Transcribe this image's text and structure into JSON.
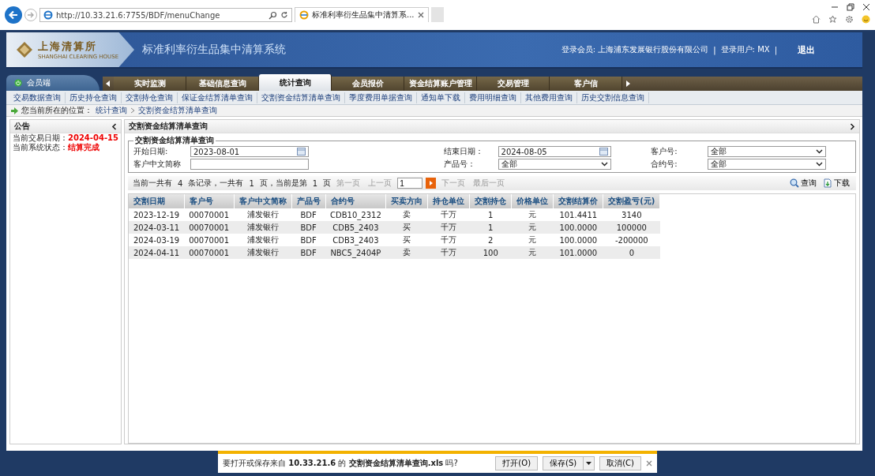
{
  "browser": {
    "address": "http://10.33.21.6:7755/BDF/menuChange",
    "tab_title": "标准利率衍生品集中清算系..."
  },
  "header": {
    "logo_text": "上海清算所",
    "logo_subtext": "SHANGHAI CLEARING HOUSE",
    "title": "标准利率衍生品集中清算系统",
    "login_member": "登录会员: 上海浦东发展银行股份有限公司",
    "login_user": "登录用户: MX",
    "separator": "|",
    "logout": "退出"
  },
  "member_tab": "会员端",
  "tabs": [
    {
      "label": "实时监测",
      "selected": false
    },
    {
      "label": "基础信息查询",
      "selected": false
    },
    {
      "label": "统计查询",
      "selected": true
    },
    {
      "label": "会员报价",
      "selected": false
    },
    {
      "label": "资金结算账户管理",
      "selected": false
    },
    {
      "label": "交易管理",
      "selected": false
    },
    {
      "label": "客户信",
      "selected": false
    }
  ],
  "submenu": [
    "交易数据查询",
    "历史持仓查询",
    "交割持仓查询",
    "保证金结算清单查询",
    "交割资金结算清单查询",
    "季度费用单据查询",
    "通知单下载",
    "费用明细查询",
    "其他费用查询",
    "历史交割信息查询"
  ],
  "breadcrumb": {
    "label": "您当前所在的位置：",
    "items": [
      "统计查询",
      "交割资金结算清单查询"
    ]
  },
  "notice": {
    "title": "公告",
    "lines": [
      {
        "label": "当前交易日期：",
        "value": "2024-04-15"
      },
      {
        "label": "当前系统状态：",
        "value": "结算完成"
      }
    ]
  },
  "panel": {
    "title": "交割资金结算清单查询",
    "legend": "交割资金结算清单查询",
    "fields": [
      {
        "kind": "date",
        "label": "开始日期:",
        "value": "2023-08-01"
      },
      {
        "kind": "date",
        "label": "结束日期：",
        "value": "2024-08-05"
      },
      {
        "kind": "select",
        "label": "客户号:",
        "value": "全部"
      },
      {
        "kind": "text",
        "label": "客户中文简称"
      },
      {
        "kind": "select",
        "label": "产品号：",
        "value": "全部"
      },
      {
        "kind": "select",
        "label": "合约号:",
        "value": "全部"
      }
    ]
  },
  "pager": {
    "text_1": "当前一共有",
    "records": "4",
    "text_2": "条记录，一共有",
    "pages": "1",
    "text_3": "页，当前是第",
    "current": "1",
    "text_4": "页",
    "page_input": "1",
    "buttons": [
      {
        "label": "第一页",
        "disabled": true
      },
      {
        "label": "上一页",
        "disabled": true
      },
      {
        "label": "下一页",
        "disabled": true
      },
      {
        "label": "最后一页",
        "disabled": true
      }
    ],
    "query": "查询",
    "download": "下载"
  },
  "table": {
    "columns": [
      "交割日期",
      "客户号",
      "客户中文简称",
      "产品号",
      "合约号",
      "买卖方向",
      "持仓单位",
      "交割持仓",
      "价格单位",
      "交割结算价",
      "交割盈亏(元)"
    ],
    "rows": [
      [
        "2023-12-19",
        "00070001",
        "浦发银行",
        "BDF",
        "CDB10_2312",
        "卖",
        "千万",
        "1",
        "元",
        "101.4411",
        "3140"
      ],
      [
        "2024-03-11",
        "00070001",
        "浦发银行",
        "BDF",
        "CDB5_2403",
        "买",
        "千万",
        "1",
        "元",
        "100.0000",
        "100000"
      ],
      [
        "2024-03-19",
        "00070001",
        "浦发银行",
        "BDF",
        "CDB3_2403",
        "买",
        "千万",
        "2",
        "元",
        "100.0000",
        "-200000"
      ],
      [
        "2024-04-11",
        "00070001",
        "浦发银行",
        "BDF",
        "NBC5_2404P",
        "卖",
        "千万",
        "100",
        "元",
        "101.0000",
        "0"
      ]
    ]
  },
  "download_bar": {
    "text": "要打开或保存来自 **10.33.21.6** 的 **交割资金结算清单查询.xls** 吗?",
    "open": "打开(O)",
    "save": "保存(S)",
    "cancel": "取消(C)"
  }
}
